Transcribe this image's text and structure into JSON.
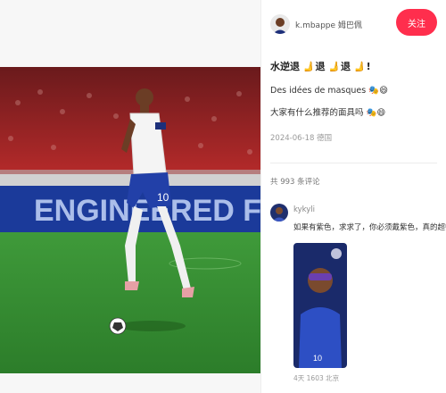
{
  "author": {
    "name": "k.mbappe 姆巴佩",
    "follow_label": "关注"
  },
  "post": {
    "title": "水逆退 🫸退 🫸退 🫸!",
    "line1": "Des idées de masques 🎭😄",
    "line2": "大家有什么推荐的面具吗 🎭😄",
    "meta": "2024-06-18 德国"
  },
  "photo": {
    "banner_text": "ENGINEERED FOR",
    "jersey_number": "10"
  },
  "comments": {
    "count_label": "共 993 条评论",
    "items": [
      {
        "user": "kykyli",
        "text": "如果有紫色，求求了，你必须戴紫色，真的超帅",
        "image_number": "10",
        "meta": "4天 1603 北京"
      }
    ]
  }
}
